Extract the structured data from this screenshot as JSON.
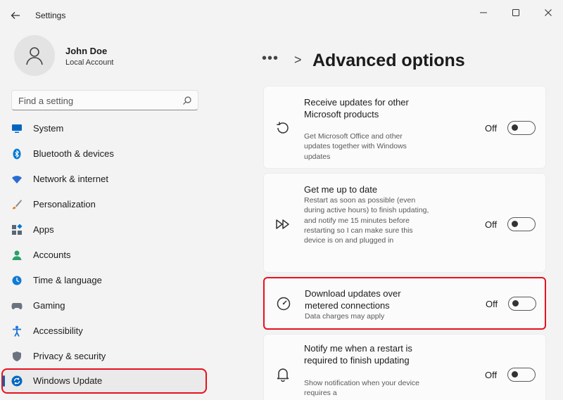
{
  "window": {
    "title": "Settings",
    "back_icon": "arrow-left-icon",
    "controls": [
      "minimize-icon",
      "maximize-icon",
      "close-icon"
    ]
  },
  "profile": {
    "name": "John Doe",
    "account_type": "Local Account",
    "avatar_icon": "person-icon"
  },
  "search": {
    "placeholder": "Find a setting",
    "icon": "search-icon"
  },
  "sidebar": {
    "items": [
      {
        "label": "System",
        "icon": "monitor-icon",
        "color": "#0067c0"
      },
      {
        "label": "Bluetooth & devices",
        "icon": "bluetooth-icon",
        "color": "#0078d4"
      },
      {
        "label": "Network & internet",
        "icon": "wifi-icon",
        "color": "#2b6cd4"
      },
      {
        "label": "Personalization",
        "icon": "brush-icon",
        "color": "#e07a1f"
      },
      {
        "label": "Apps",
        "icon": "apps-icon",
        "color": "#5a6575"
      },
      {
        "label": "Accounts",
        "icon": "account-icon",
        "color": "#2aa06a"
      },
      {
        "label": "Time & language",
        "icon": "globe-clock-icon",
        "color": "#0f7bd6"
      },
      {
        "label": "Gaming",
        "icon": "controller-icon",
        "color": "#6b7280"
      },
      {
        "label": "Accessibility",
        "icon": "accessibility-icon",
        "color": "#1a73d9"
      },
      {
        "label": "Privacy & security",
        "icon": "shield-icon",
        "color": "#6b7280"
      },
      {
        "label": "Windows Update",
        "icon": "sync-icon",
        "color": "#0067c0",
        "active": true
      }
    ]
  },
  "main": {
    "breadcrumb_more": "•••",
    "breadcrumb_separator": ">",
    "title": "Advanced options",
    "cards": [
      {
        "title": "Receive updates for other Microsoft products",
        "description": "Get Microsoft Office and other updates together with Windows updates",
        "state": "Off",
        "icon": "history-icon"
      },
      {
        "title": "Get me up to date",
        "description": "Restart as soon as possible (even during active hours) to finish updating, and notify me 15 minutes before restarting so I can make sure this device is on and plugged in",
        "state": "Off",
        "icon": "fast-forward-icon"
      },
      {
        "title": "Download updates over metered connections",
        "description": "Data charges may apply",
        "state": "Off",
        "icon": "gauge-icon"
      },
      {
        "title": "Notify me when a restart is required to finish updating",
        "description": "Show notification when your device requires a",
        "state": "Off",
        "icon": "bell-icon"
      }
    ]
  },
  "colors": {
    "accent": "#005fb8",
    "highlight": "#e8101e",
    "background": "#f3f3f3",
    "card": "#fbfbfb"
  }
}
